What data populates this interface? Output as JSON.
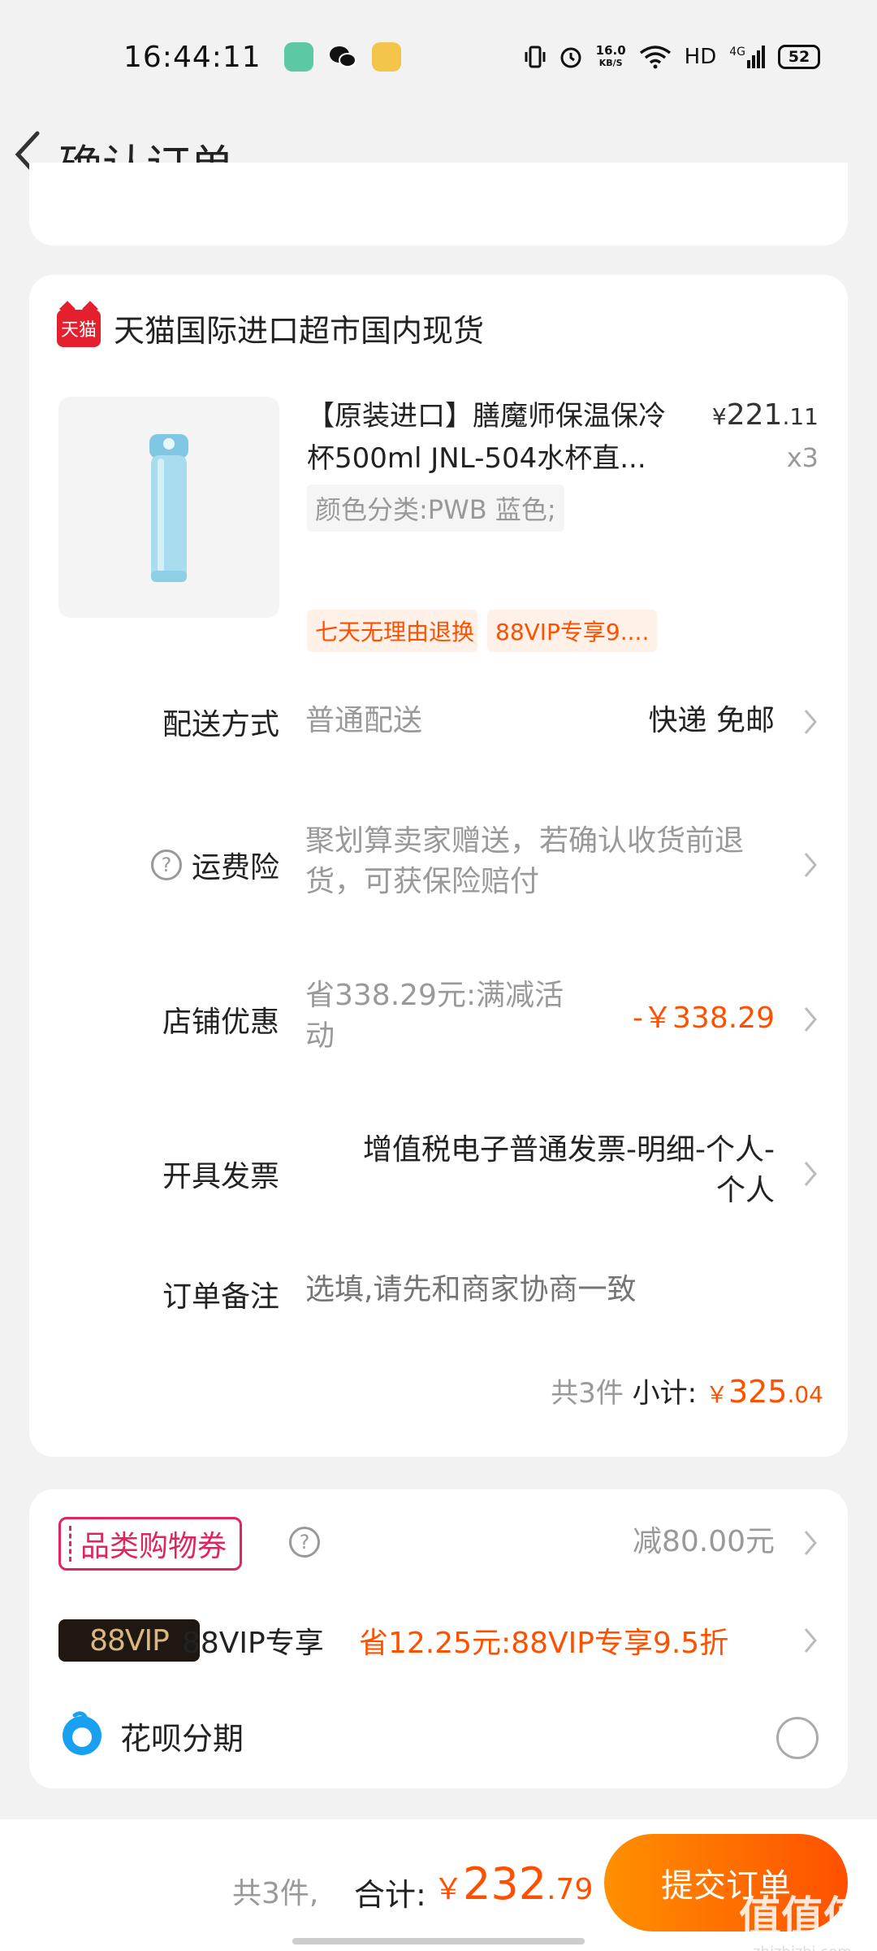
{
  "status_bar": {
    "time": "16:44:11",
    "net_speed": "16.0",
    "net_unit": "KB/S",
    "hd": "HD",
    "signal": "4G",
    "battery": "52",
    "icons": [
      "vibrate-icon",
      "alarm-icon",
      "wifi-icon",
      "signal-icon",
      "battery-icon"
    ]
  },
  "nav": {
    "title": "确认订单"
  },
  "shop": {
    "logo_text": "天猫",
    "name": "天猫国际进口超市国内现货"
  },
  "product": {
    "title": "【原装进口】膳魔师保温保冷杯500ml JNL-504水杯直...",
    "price_symbol": "¥",
    "price_int": "221",
    "price_dec": ".11",
    "qty": "x3",
    "sku": "颜色分类:PWB 蓝色;",
    "tags": [
      "七天无理由退换",
      "88VIP专享9...."
    ],
    "image_color": "#a8dcef"
  },
  "rows": {
    "delivery": {
      "label": "配送方式",
      "value": "普通配送",
      "right": "快递 免邮"
    },
    "insurance": {
      "label": "运费险",
      "value": "聚划算卖家赠送，若确认收货前退货，可获保险赔付"
    },
    "discount": {
      "label": "店铺优惠",
      "value": "省338.29元:满减活动",
      "right": "-￥338.29"
    },
    "invoice": {
      "label": "开具发票",
      "right": "增值税电子普通发票-明细-个人-个人"
    },
    "note": {
      "label": "订单备注",
      "placeholder": "选填,请先和商家协商一致"
    }
  },
  "subtotal": {
    "count": "共3件",
    "label": "小计:",
    "symbol": "￥",
    "int": "325",
    "dec": ".04"
  },
  "promo": {
    "coupon_label": "品类购物券",
    "coupon_value": "减80.00元",
    "vip_badge": "88VIP",
    "vip_label": "88VIP专享",
    "vip_value": "省12.25元:88VIP专享9.5折",
    "huabei_label": "花呗分期"
  },
  "bottom": {
    "count": "共3件,",
    "label": "合计:",
    "symbol": "￥",
    "int": "232",
    "dec": ".79",
    "submit": "提交订单"
  },
  "watermark": {
    "text": "值值值",
    "sub": "zhizhizhi.com"
  },
  "colors": {
    "accent": "#ff5000",
    "coupon": "#e0245e",
    "tmall": "#e4202e"
  }
}
